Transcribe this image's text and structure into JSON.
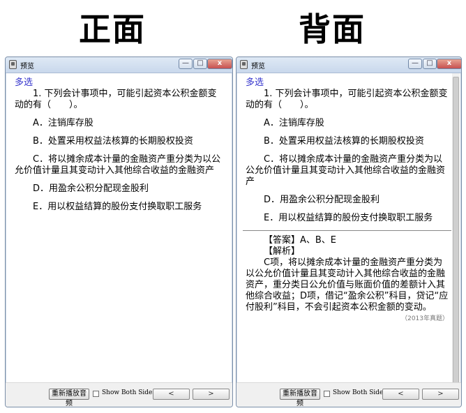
{
  "headings": {
    "front": "正面",
    "back": "背面"
  },
  "window": {
    "title": "预览",
    "minimize": "—",
    "maximize": "□",
    "close": "x"
  },
  "question": {
    "type": "多选",
    "stem": "1. 下列会计事项中，可能引起资本公积金额变动的有（　　）。",
    "options": [
      "A．注销库存股",
      "B．处置采用权益法核算的长期股权投资",
      "C．将以摊余成本计量的金融资产重分类为以公允价值计量且其变动计入其他综合收益的金融资产",
      "D．用盈余公积分配现金股利",
      "E．用以权益结算的股份支付换取职工服务"
    ]
  },
  "answer": {
    "answer_line": "【答案】A、B、E",
    "analysis_label": "【解析】",
    "analysis": "C项，将以摊余成本计量的金融资产重分类为以公允价值计量且其变动计入其他综合收益的金融资产，重分类日公允价值与账面价值的差额计入其他综合收益；D项，借记“盈余公积”科目，贷记“应付股利”科目，不会引起资本公积金额的变动。",
    "source": "（2013年真题）"
  },
  "bottom": {
    "replay_label": "重新播放音频",
    "show_both_label": "Show Both Sides",
    "prev_label": "<",
    "next_label": ">"
  },
  "icons": {
    "app": "card-icon",
    "checkbox": "checkbox-icon"
  }
}
